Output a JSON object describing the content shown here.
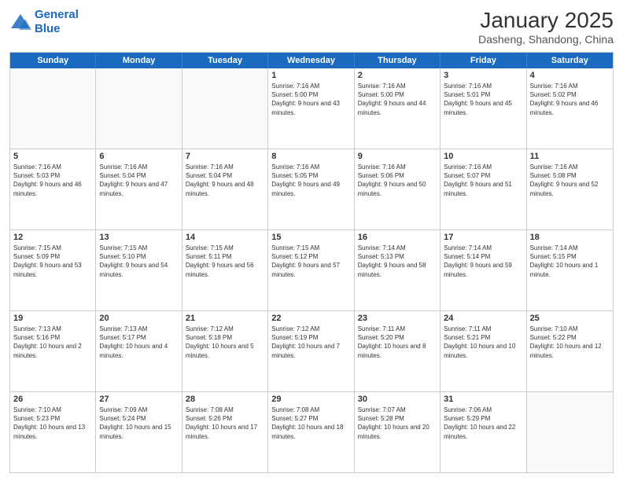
{
  "header": {
    "logo_line1": "General",
    "logo_line2": "Blue",
    "month_title": "January 2025",
    "subtitle": "Dasheng, Shandong, China"
  },
  "day_headers": [
    "Sunday",
    "Monday",
    "Tuesday",
    "Wednesday",
    "Thursday",
    "Friday",
    "Saturday"
  ],
  "weeks": [
    [
      {
        "day": "",
        "info": ""
      },
      {
        "day": "",
        "info": ""
      },
      {
        "day": "",
        "info": ""
      },
      {
        "day": "1",
        "info": "Sunrise: 7:16 AM\nSunset: 5:00 PM\nDaylight: 9 hours and 43 minutes."
      },
      {
        "day": "2",
        "info": "Sunrise: 7:16 AM\nSunset: 5:00 PM\nDaylight: 9 hours and 44 minutes."
      },
      {
        "day": "3",
        "info": "Sunrise: 7:16 AM\nSunset: 5:01 PM\nDaylight: 9 hours and 45 minutes."
      },
      {
        "day": "4",
        "info": "Sunrise: 7:16 AM\nSunset: 5:02 PM\nDaylight: 9 hours and 46 minutes."
      }
    ],
    [
      {
        "day": "5",
        "info": "Sunrise: 7:16 AM\nSunset: 5:03 PM\nDaylight: 9 hours and 46 minutes."
      },
      {
        "day": "6",
        "info": "Sunrise: 7:16 AM\nSunset: 5:04 PM\nDaylight: 9 hours and 47 minutes."
      },
      {
        "day": "7",
        "info": "Sunrise: 7:16 AM\nSunset: 5:04 PM\nDaylight: 9 hours and 48 minutes."
      },
      {
        "day": "8",
        "info": "Sunrise: 7:16 AM\nSunset: 5:05 PM\nDaylight: 9 hours and 49 minutes."
      },
      {
        "day": "9",
        "info": "Sunrise: 7:16 AM\nSunset: 5:06 PM\nDaylight: 9 hours and 50 minutes."
      },
      {
        "day": "10",
        "info": "Sunrise: 7:16 AM\nSunset: 5:07 PM\nDaylight: 9 hours and 51 minutes."
      },
      {
        "day": "11",
        "info": "Sunrise: 7:16 AM\nSunset: 5:08 PM\nDaylight: 9 hours and 52 minutes."
      }
    ],
    [
      {
        "day": "12",
        "info": "Sunrise: 7:15 AM\nSunset: 5:09 PM\nDaylight: 9 hours and 53 minutes."
      },
      {
        "day": "13",
        "info": "Sunrise: 7:15 AM\nSunset: 5:10 PM\nDaylight: 9 hours and 54 minutes."
      },
      {
        "day": "14",
        "info": "Sunrise: 7:15 AM\nSunset: 5:11 PM\nDaylight: 9 hours and 56 minutes."
      },
      {
        "day": "15",
        "info": "Sunrise: 7:15 AM\nSunset: 5:12 PM\nDaylight: 9 hours and 57 minutes."
      },
      {
        "day": "16",
        "info": "Sunrise: 7:14 AM\nSunset: 5:13 PM\nDaylight: 9 hours and 58 minutes."
      },
      {
        "day": "17",
        "info": "Sunrise: 7:14 AM\nSunset: 5:14 PM\nDaylight: 9 hours and 59 minutes."
      },
      {
        "day": "18",
        "info": "Sunrise: 7:14 AM\nSunset: 5:15 PM\nDaylight: 10 hours and 1 minute."
      }
    ],
    [
      {
        "day": "19",
        "info": "Sunrise: 7:13 AM\nSunset: 5:16 PM\nDaylight: 10 hours and 2 minutes."
      },
      {
        "day": "20",
        "info": "Sunrise: 7:13 AM\nSunset: 5:17 PM\nDaylight: 10 hours and 4 minutes."
      },
      {
        "day": "21",
        "info": "Sunrise: 7:12 AM\nSunset: 5:18 PM\nDaylight: 10 hours and 5 minutes."
      },
      {
        "day": "22",
        "info": "Sunrise: 7:12 AM\nSunset: 5:19 PM\nDaylight: 10 hours and 7 minutes."
      },
      {
        "day": "23",
        "info": "Sunrise: 7:11 AM\nSunset: 5:20 PM\nDaylight: 10 hours and 8 minutes."
      },
      {
        "day": "24",
        "info": "Sunrise: 7:11 AM\nSunset: 5:21 PM\nDaylight: 10 hours and 10 minutes."
      },
      {
        "day": "25",
        "info": "Sunrise: 7:10 AM\nSunset: 5:22 PM\nDaylight: 10 hours and 12 minutes."
      }
    ],
    [
      {
        "day": "26",
        "info": "Sunrise: 7:10 AM\nSunset: 5:23 PM\nDaylight: 10 hours and 13 minutes."
      },
      {
        "day": "27",
        "info": "Sunrise: 7:09 AM\nSunset: 5:24 PM\nDaylight: 10 hours and 15 minutes."
      },
      {
        "day": "28",
        "info": "Sunrise: 7:08 AM\nSunset: 5:26 PM\nDaylight: 10 hours and 17 minutes."
      },
      {
        "day": "29",
        "info": "Sunrise: 7:08 AM\nSunset: 5:27 PM\nDaylight: 10 hours and 18 minutes."
      },
      {
        "day": "30",
        "info": "Sunrise: 7:07 AM\nSunset: 5:28 PM\nDaylight: 10 hours and 20 minutes."
      },
      {
        "day": "31",
        "info": "Sunrise: 7:06 AM\nSunset: 5:29 PM\nDaylight: 10 hours and 22 minutes."
      },
      {
        "day": "",
        "info": ""
      }
    ]
  ]
}
